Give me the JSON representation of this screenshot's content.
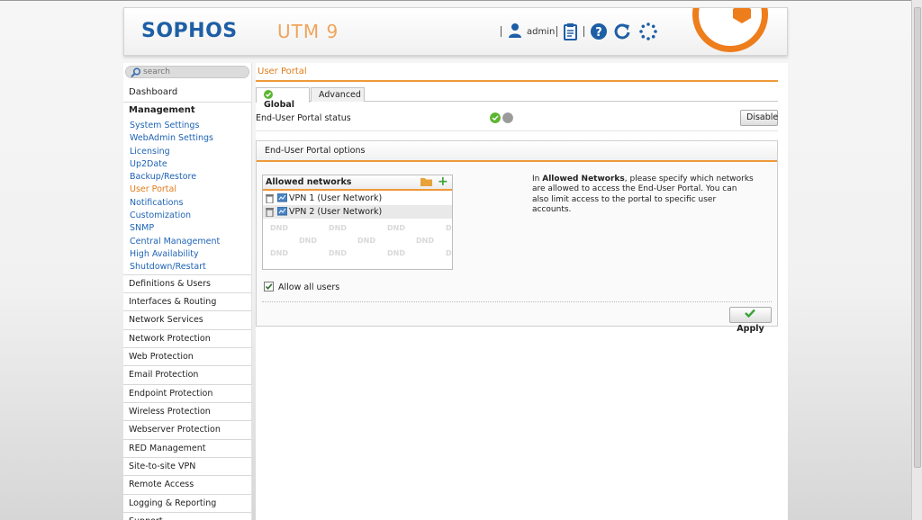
{
  "header": {
    "logo": "SOPHOS",
    "product": "UTM 9",
    "user": "admin",
    "icons": [
      "user-icon",
      "clipboard-icon",
      "help-icon",
      "reload-icon",
      "activity-spinner-icon"
    ]
  },
  "sidebar": {
    "search_placeholder": "search",
    "dashboard": "Dashboard",
    "group_title": "Management",
    "subitems": [
      {
        "label": "System Settings"
      },
      {
        "label": "WebAdmin Settings"
      },
      {
        "label": "Licensing"
      },
      {
        "label": "Up2Date"
      },
      {
        "label": "Backup/Restore"
      },
      {
        "label": "User Portal",
        "active": true
      },
      {
        "label": "Notifications"
      },
      {
        "label": "Customization"
      },
      {
        "label": "SNMP"
      },
      {
        "label": "Central Management"
      },
      {
        "label": "High Availability"
      },
      {
        "label": "Shutdown/Restart"
      }
    ],
    "items": [
      {
        "label": "Definitions & Users"
      },
      {
        "label": "Interfaces & Routing"
      },
      {
        "label": "Network Services"
      },
      {
        "label": "Network Protection"
      },
      {
        "label": "Web Protection"
      },
      {
        "label": "Email Protection"
      },
      {
        "label": "Endpoint Protection"
      },
      {
        "label": "Wireless Protection"
      },
      {
        "label": "Webserver Protection"
      },
      {
        "label": "RED Management"
      },
      {
        "label": "Site-to-site VPN"
      },
      {
        "label": "Remote Access"
      },
      {
        "label": "Logging & Reporting"
      },
      {
        "label": "Support"
      }
    ]
  },
  "main": {
    "page_title": "User Portal",
    "tabs": [
      {
        "label": "Global",
        "active": true
      },
      {
        "label": "Advanced"
      }
    ],
    "status": {
      "label": "End-User Portal status",
      "on_color": "#5cb531",
      "off_color": "#9b9b9b",
      "button": "Disable"
    },
    "panel": {
      "title": "End-User Portal options",
      "networks_header": "Allowed networks",
      "networks": [
        {
          "name": "VPN 1 (User Network)"
        },
        {
          "name": "VPN 2 (User Network)"
        }
      ],
      "dnd_label": "DND",
      "help_prefix": "In ",
      "help_bold": "Allowed Networks",
      "help_suffix": ", please specify which networks are allowed to access the End-User Portal. You can also limit access to the portal to specific user accounts.",
      "allow_all_label": "Allow all users",
      "allow_all_checked": true,
      "apply_label": "Apply"
    }
  },
  "colors": {
    "brand_blue": "#1d5fa6",
    "accent_orange": "#ee7d1c",
    "link_blue": "#1e63b5"
  }
}
